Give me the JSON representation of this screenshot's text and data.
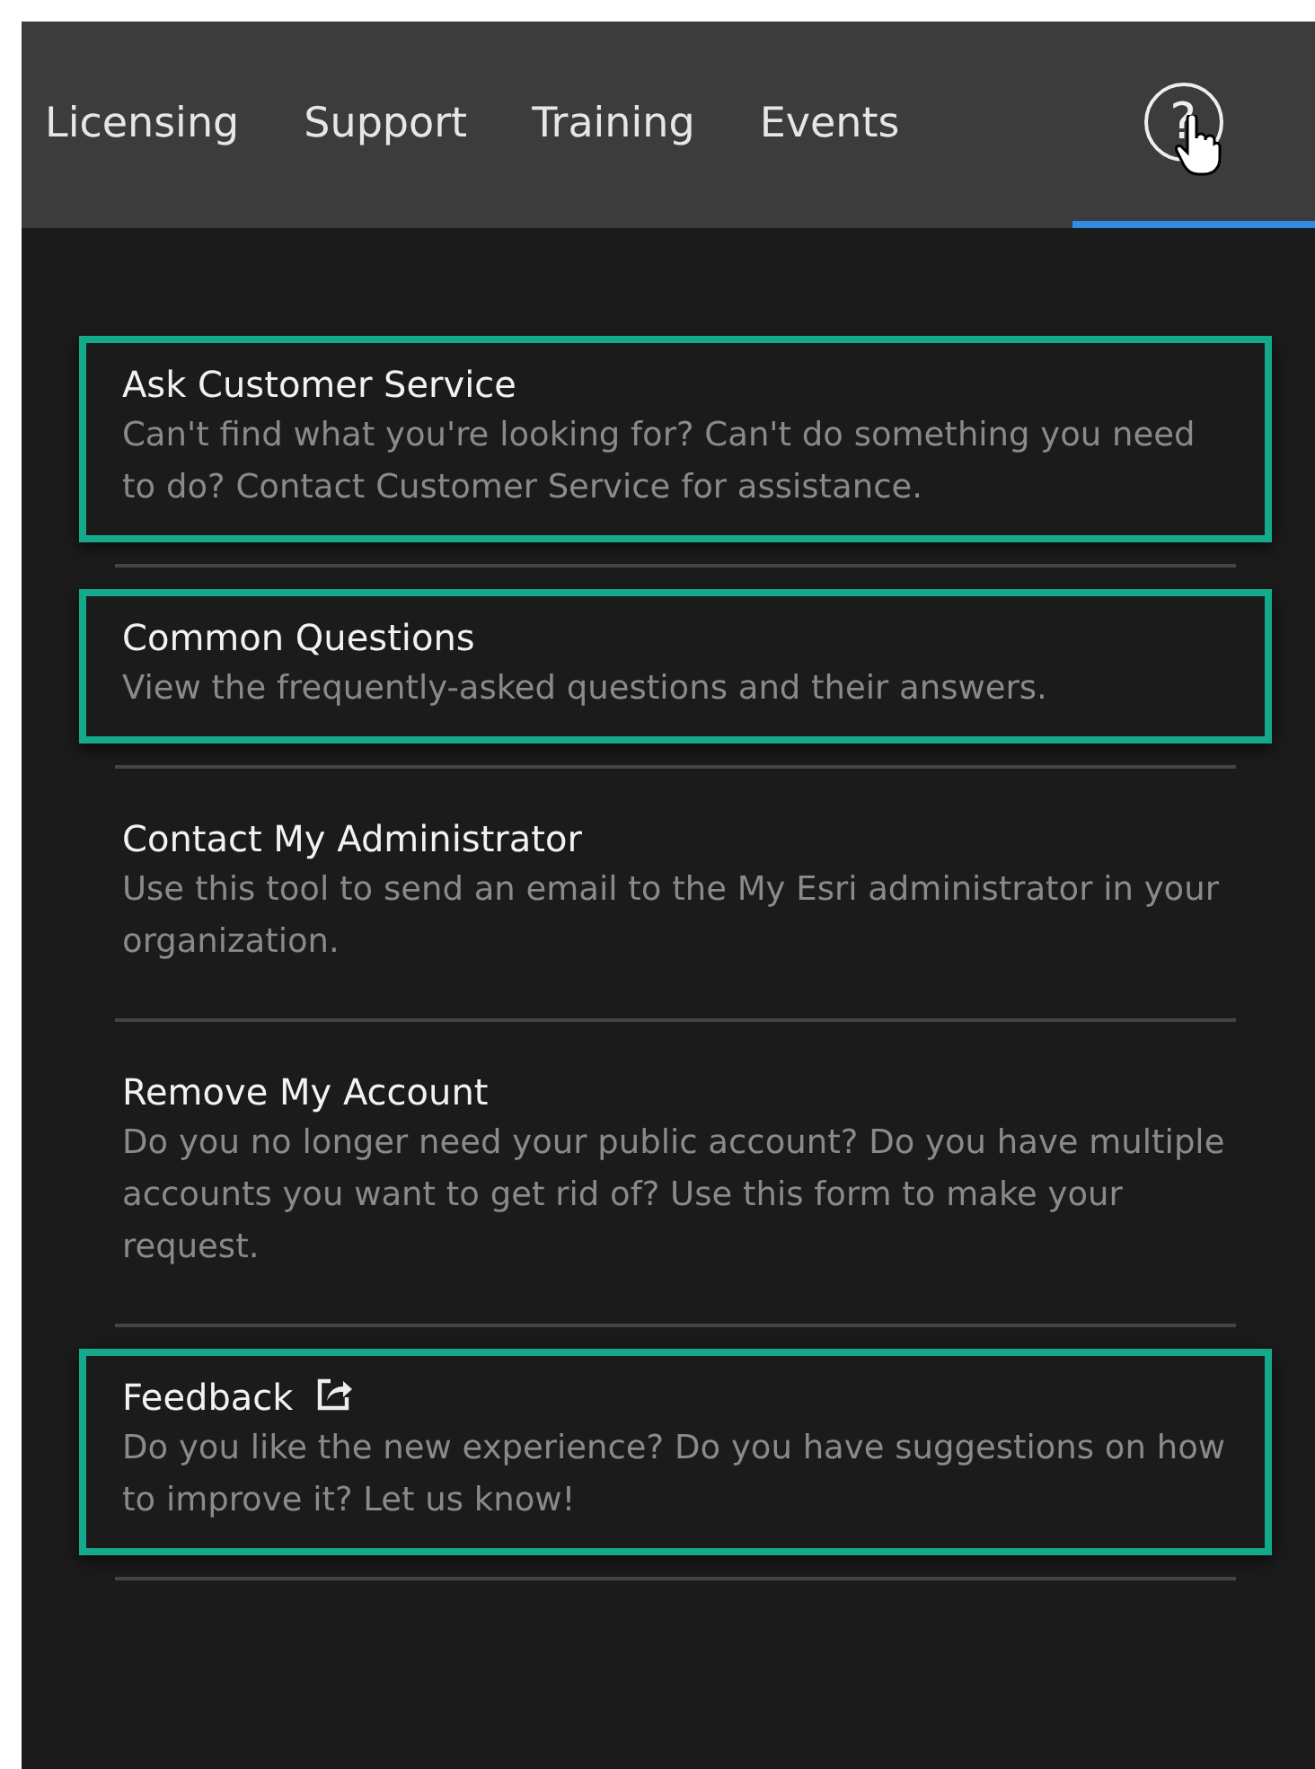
{
  "nav": {
    "tabs": [
      {
        "label": "Licensing",
        "selected": false
      },
      {
        "label": "Support",
        "selected": false
      },
      {
        "label": "Training",
        "selected": false
      },
      {
        "label": "Events",
        "selected": false
      }
    ],
    "help": {
      "label": "?",
      "selected": true
    }
  },
  "items": [
    {
      "title": "Ask Customer Service",
      "description": "Can't find what you're looking for? Can't do something you need to do? Contact Customer Service for assistance.",
      "highlighted": true,
      "external": false
    },
    {
      "title": "Common Questions",
      "description": "View the frequently-asked questions and their answers.",
      "highlighted": true,
      "external": false
    },
    {
      "title": "Contact My Administrator",
      "description": "Use this tool to send an email to the My Esri administrator in your organization.",
      "highlighted": false,
      "external": false
    },
    {
      "title": "Remove My Account",
      "description": "Do you no longer need your public account? Do you have multiple accounts you want to get rid of? Use this form to make your request.",
      "highlighted": false,
      "external": false
    },
    {
      "title": "Feedback",
      "description": "Do you like the new experience? Do you have suggestions on how to improve it? Let us know!",
      "highlighted": true,
      "external": true
    }
  ]
}
